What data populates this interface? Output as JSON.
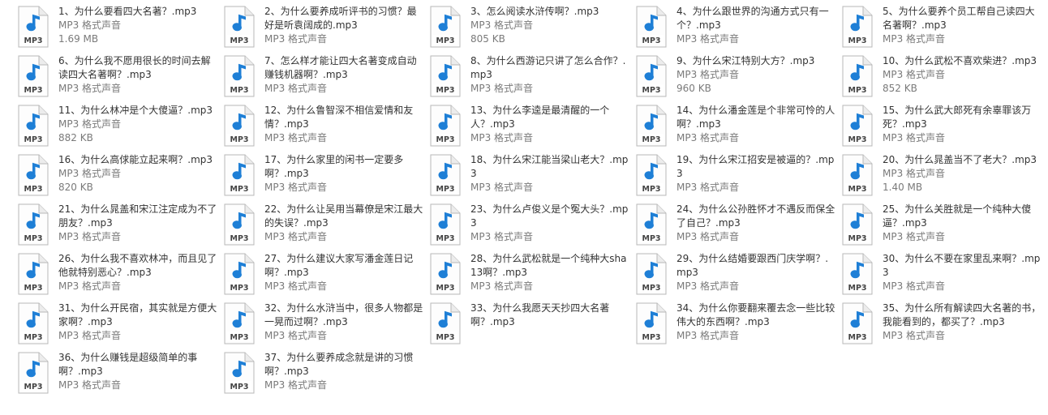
{
  "icon": {
    "name": "mp3-file-icon",
    "label": "MP3",
    "note_color": "#1e7fd6"
  },
  "files": [
    {
      "name": "1、为什么要看四大名著？.mp3",
      "type": "MP3 格式声音",
      "size": "1.69 MB"
    },
    {
      "name": "2、为什么要养成听评书的习惯？最好是听袁阔成的.mp3",
      "type": "MP3 格式声音",
      "size": ""
    },
    {
      "name": "3、怎么阅读水浒传啊？.mp3",
      "type": "MP3 格式声音",
      "size": "805 KB"
    },
    {
      "name": "4、为什么跟世界的沟通方式只有一个？.mp3",
      "type": "MP3 格式声音",
      "size": ""
    },
    {
      "name": "5、为什么要养个员工帮自己读四大名著啊？.mp3",
      "type": "MP3 格式声音",
      "size": ""
    },
    {
      "name": "6、为什么我不愿用很长的时间去解读四大名著啊？.mp3",
      "type": "MP3 格式声音",
      "size": ""
    },
    {
      "name": "7、怎么样才能让四大名著变成自动赚钱机器啊？.mp3",
      "type": "MP3 格式声音",
      "size": ""
    },
    {
      "name": "8、为什么西游记只讲了怎么合作？.mp3",
      "type": "MP3 格式声音",
      "size": ""
    },
    {
      "name": "9、为什么宋江特别大方？.mp3",
      "type": "MP3 格式声音",
      "size": "960 KB"
    },
    {
      "name": "10、为什么武松不喜欢柴进？.mp3",
      "type": "MP3 格式声音",
      "size": "852 KB"
    },
    {
      "name": "11、为什么林冲是个大傻逼？.mp3",
      "type": "MP3 格式声音",
      "size": "882 KB"
    },
    {
      "name": "12、为什么鲁智深不相信爱情和友情？.mp3",
      "type": "MP3 格式声音",
      "size": ""
    },
    {
      "name": "13、为什么李逵是最清醒的一个人？.mp3",
      "type": "MP3 格式声音",
      "size": ""
    },
    {
      "name": "14、为什么潘金莲是个非常可怜的人啊？.mp3",
      "type": "MP3 格式声音",
      "size": ""
    },
    {
      "name": "15、为什么武大郎死有余辜罪该万死？.mp3",
      "type": "MP3 格式声音",
      "size": ""
    },
    {
      "name": "16、为什么高俅能立起来啊？.mp3",
      "type": "MP3 格式声音",
      "size": "820 KB"
    },
    {
      "name": "17、为什么家里的闲书一定要多啊？.mp3",
      "type": "MP3 格式声音",
      "size": ""
    },
    {
      "name": "18、为什么宋江能当梁山老大？.mp3",
      "type": "MP3 格式声音",
      "size": ""
    },
    {
      "name": "19、为什么宋江招安是被逼的？.mp3",
      "type": "MP3 格式声音",
      "size": ""
    },
    {
      "name": "20、为什么晁盖当不了老大？.mp3",
      "type": "MP3 格式声音",
      "size": "1.40 MB"
    },
    {
      "name": "21、为什么晁盖和宋江注定成为不了朋友？.mp3",
      "type": "MP3 格式声音",
      "size": ""
    },
    {
      "name": "22、为什么让吴用当幕僚是宋江最大的失误？.mp3",
      "type": "MP3 格式声音",
      "size": ""
    },
    {
      "name": "23、为什么卢俊义是个冤大头？.mp3",
      "type": "MP3 格式声音",
      "size": ""
    },
    {
      "name": "24、为什么公孙胜怀才不遇反而保全了自己？.mp3",
      "type": "MP3 格式声音",
      "size": ""
    },
    {
      "name": "25、为什么关胜就是一个纯种大傻逼？.mp3",
      "type": "MP3 格式声音",
      "size": ""
    },
    {
      "name": "26、为什么我不喜欢林冲，而且见了他就特别恶心？.mp3",
      "type": "MP3 格式声音",
      "size": ""
    },
    {
      "name": "27、为什么建议大家写潘金莲日记啊？.mp3",
      "type": "MP3 格式声音",
      "size": ""
    },
    {
      "name": "28、为什么武松就是一个纯种大sha13啊？.mp3",
      "type": "MP3 格式声音",
      "size": ""
    },
    {
      "name": "29、为什么结婚要跟西门庆学啊？.mp3",
      "type": "MP3 格式声音",
      "size": ""
    },
    {
      "name": "30、为什么不要在家里乱来啊？.mp3",
      "type": "MP3 格式声音",
      "size": ""
    },
    {
      "name": "31、为什么开民宿，其实就是方便大家啊？.mp3",
      "type": "MP3 格式声音",
      "size": ""
    },
    {
      "name": "32、为什么水浒当中，很多人物都是一晃而过啊？.mp3",
      "type": "MP3 格式声音",
      "size": ""
    },
    {
      "name": "33、为什么我愿天天抄四大名著啊？.mp3",
      "type": "",
      "size": ""
    },
    {
      "name": "34、为什么你要翻来覆去念一些比较伟大的东西啊？.mp3",
      "type": "MP3 格式声音",
      "size": ""
    },
    {
      "name": "35、为什么所有解读四大名著的书，我能看到的，都买了？.mp3",
      "type": "MP3 格式声音",
      "size": ""
    },
    {
      "name": "36、为什么赚钱是超级简单的事啊？.mp3",
      "type": "MP3 格式声音",
      "size": ""
    },
    {
      "name": "37、为什么要养成念就是讲的习惯啊？.mp3",
      "type": "MP3 格式声音",
      "size": ""
    }
  ]
}
